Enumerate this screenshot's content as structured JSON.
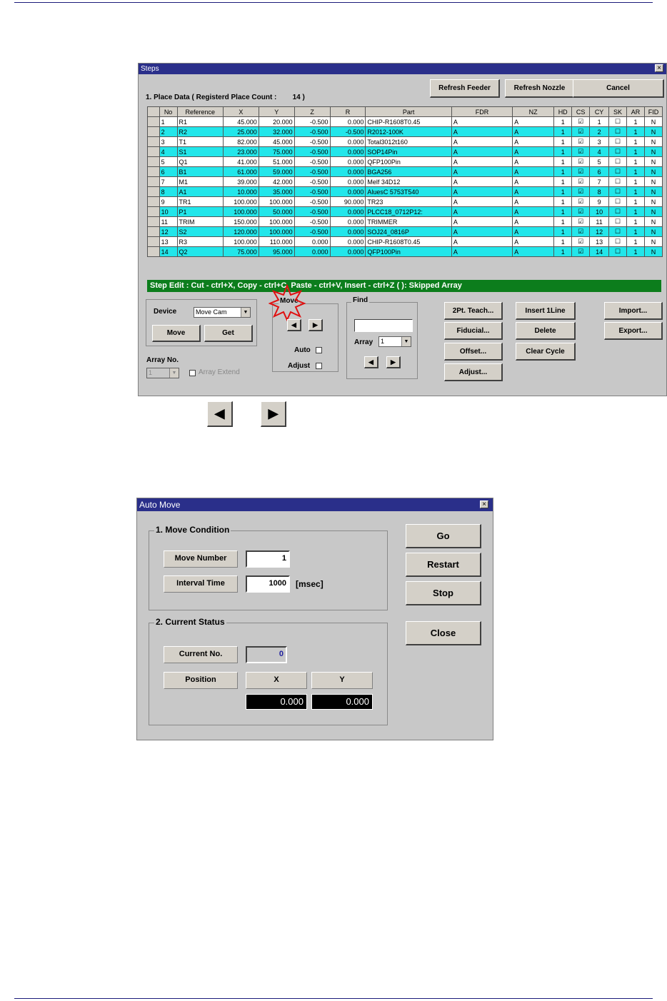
{
  "steps": {
    "title": "Steps",
    "close": "×",
    "place_data_label": "1. Place Data ( Registerd Place Count :",
    "place_count": "14 )",
    "refresh_feeder": "Refresh Feeder",
    "refresh_nozzle": "Refresh Nozzle",
    "cancel": "Cancel",
    "columns": [
      "No",
      "Reference",
      "X",
      "Y",
      "Z",
      "R",
      "Part",
      "FDR",
      "NZ",
      "HD",
      "CS",
      "CY",
      "SK",
      "AR",
      "FID"
    ],
    "rows": [
      {
        "no": "1",
        "ref": "R1",
        "x": "45.000",
        "y": "20.000",
        "z": "-0.500",
        "r": "0.000",
        "part": "CHIP-R1608T0.45",
        "fdr": "A",
        "nz": "A",
        "hd": "1",
        "cs": "☑",
        "cy": "1",
        "sk": "☐",
        "ar": "1",
        "fid": "N"
      },
      {
        "no": "2",
        "ref": "R2",
        "x": "25.000",
        "y": "32.000",
        "z": "-0.500",
        "r": "-0.500",
        "part": "R2012-100K",
        "fdr": "A",
        "nz": "A",
        "hd": "1",
        "cs": "☑",
        "cy": "2",
        "sk": "☐",
        "ar": "1",
        "fid": "N"
      },
      {
        "no": "3",
        "ref": "T1",
        "x": "82.000",
        "y": "45.000",
        "z": "-0.500",
        "r": "0.000",
        "part": "Total3012t160",
        "fdr": "A",
        "nz": "A",
        "hd": "1",
        "cs": "☑",
        "cy": "3",
        "sk": "☐",
        "ar": "1",
        "fid": "N"
      },
      {
        "no": "4",
        "ref": "S1",
        "x": "23.000",
        "y": "75.000",
        "z": "-0.500",
        "r": "0.000",
        "part": "SOP14Pin",
        "fdr": "A",
        "nz": "A",
        "hd": "1",
        "cs": "☑",
        "cy": "4",
        "sk": "☐",
        "ar": "1",
        "fid": "N"
      },
      {
        "no": "5",
        "ref": "Q1",
        "x": "41.000",
        "y": "51.000",
        "z": "-0.500",
        "r": "0.000",
        "part": "QFP100Pin",
        "fdr": "A",
        "nz": "A",
        "hd": "1",
        "cs": "☑",
        "cy": "5",
        "sk": "☐",
        "ar": "1",
        "fid": "N"
      },
      {
        "no": "6",
        "ref": "B1",
        "x": "61.000",
        "y": "59.000",
        "z": "-0.500",
        "r": "0.000",
        "part": "BGA256",
        "fdr": "A",
        "nz": "A",
        "hd": "1",
        "cs": "☑",
        "cy": "6",
        "sk": "☐",
        "ar": "1",
        "fid": "N"
      },
      {
        "no": "7",
        "ref": "M1",
        "x": "39.000",
        "y": "42.000",
        "z": "-0.500",
        "r": "0.000",
        "part": "Melf 34D12",
        "fdr": "A",
        "nz": "A",
        "hd": "1",
        "cs": "☑",
        "cy": "7",
        "sk": "☐",
        "ar": "1",
        "fid": "N"
      },
      {
        "no": "8",
        "ref": "A1",
        "x": "10.000",
        "y": "35.000",
        "z": "-0.500",
        "r": "0.000",
        "part": "AluesC 5753T540",
        "fdr": "A",
        "nz": "A",
        "hd": "1",
        "cs": "☑",
        "cy": "8",
        "sk": "☐",
        "ar": "1",
        "fid": "N"
      },
      {
        "no": "9",
        "ref": "TR1",
        "x": "100.000",
        "y": "100.000",
        "z": "-0.500",
        "r": "90.000",
        "part": "TR23",
        "fdr": "A",
        "nz": "A",
        "hd": "1",
        "cs": "☑",
        "cy": "9",
        "sk": "☐",
        "ar": "1",
        "fid": "N"
      },
      {
        "no": "10",
        "ref": "P1",
        "x": "100.000",
        "y": "50.000",
        "z": "-0.500",
        "r": "0.000",
        "part": "PLCC18_0712P12:",
        "fdr": "A",
        "nz": "A",
        "hd": "1",
        "cs": "☑",
        "cy": "10",
        "sk": "☐",
        "ar": "1",
        "fid": "N"
      },
      {
        "no": "11",
        "ref": "TRIM",
        "x": "150.000",
        "y": "100.000",
        "z": "-0.500",
        "r": "0.000",
        "part": "TRIMMER",
        "fdr": "A",
        "nz": "A",
        "hd": "1",
        "cs": "☑",
        "cy": "11",
        "sk": "☐",
        "ar": "1",
        "fid": "N"
      },
      {
        "no": "12",
        "ref": "S2",
        "x": "120.000",
        "y": "100.000",
        "z": "-0.500",
        "r": "0.000",
        "part": "SOJ24_0816P",
        "fdr": "A",
        "nz": "A",
        "hd": "1",
        "cs": "☑",
        "cy": "12",
        "sk": "☐",
        "ar": "1",
        "fid": "N"
      },
      {
        "no": "13",
        "ref": "R3",
        "x": "100.000",
        "y": "110.000",
        "z": "0.000",
        "r": "0.000",
        "part": "CHIP-R1608T0.45",
        "fdr": "A",
        "nz": "A",
        "hd": "1",
        "cs": "☑",
        "cy": "13",
        "sk": "☐",
        "ar": "1",
        "fid": "N"
      },
      {
        "no": "14",
        "ref": "Q2",
        "x": "75.000",
        "y": "95.000",
        "z": "0.000",
        "r": "0.000",
        "part": "QFP100Pin",
        "fdr": "A",
        "nz": "A",
        "hd": "1",
        "cs": "☑",
        "cy": "14",
        "sk": "☐",
        "ar": "1",
        "fid": "N"
      }
    ],
    "status_bar": "Step Edit : Cut - ctrl+X,  Copy - ctrl+C,  Paste - ctrl+V,  Insert - ctrl+Z       ( ): Skipped Array",
    "device_label": "Device",
    "device_value": "Move Cam",
    "move_btn": "Move",
    "get_btn": "Get",
    "array_no_label": "Array No.",
    "array_no_value": "1",
    "array_extend": "Array Extend",
    "move_group": "Move",
    "auto_label": "Auto",
    "adjust_label": "Adjust",
    "find_group": "Find",
    "find_array_label": "Array",
    "find_array_value": "1",
    "btn_2pt_teach": "2Pt. Teach...",
    "btn_fiducial": "Fiducial...",
    "btn_offset": "Offset...",
    "btn_adjust": "Adjust...",
    "btn_insert_line": "Insert 1Line",
    "btn_delete": "Delete",
    "btn_clear_cycle": "Clear Cycle",
    "btn_import": "Import...",
    "btn_export": "Export..."
  },
  "arrows": {
    "left": "◀",
    "right": "▶"
  },
  "auto_move": {
    "title": "Auto Move",
    "close": "×",
    "move_condition": "1. Move Condition",
    "move_number_label": "Move Number",
    "move_number_value": "1",
    "interval_time_label": "Interval Time",
    "interval_time_value": "1000",
    "interval_unit": "[msec]",
    "current_status": "2. Current Status",
    "current_no_label": "Current No.",
    "current_no_value": "0",
    "position_label": "Position",
    "x_label": "X",
    "y_label": "Y",
    "x_value": "0.000",
    "y_value": "0.000",
    "go": "Go",
    "restart": "Restart",
    "stop": "Stop",
    "close_btn": "Close"
  },
  "colors": {
    "row_highlight": "#22e6ea",
    "status_bar": "#0c7d1c",
    "title_bar": "#2a2f8a"
  }
}
